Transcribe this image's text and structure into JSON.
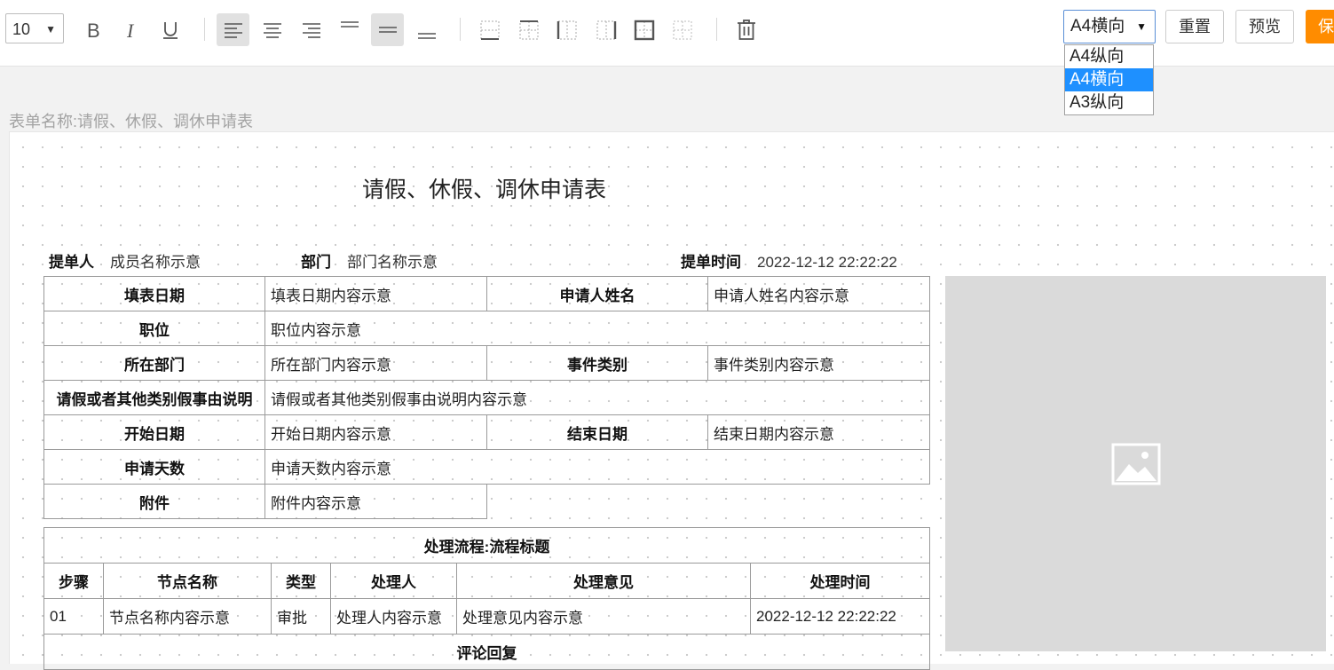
{
  "toolbar": {
    "font_size": "10",
    "paper_size": "A4横向",
    "reset_label": "重置",
    "preview_label": "预览",
    "primary_label": "保",
    "paper_options": [
      "A4纵向",
      "A4横向",
      "A3纵向"
    ]
  },
  "form_name": {
    "label": "表单名称:",
    "value": "请假、休假、调休申请表"
  },
  "document": {
    "title": "请假、休假、调休申请表",
    "submitter_label": "提单人",
    "submitter_value": "成员名称示意",
    "dept_label": "部门",
    "dept_value": "部门名称示意",
    "time_label": "提单时间",
    "time_value": "2022-12-12 22:22:22",
    "rows": {
      "fill_date_label": "填表日期",
      "fill_date_value": "填表日期内容示意",
      "applicant_label": "申请人姓名",
      "applicant_value": "申请人姓名内容示意",
      "position_label": "职位",
      "position_value": "职位内容示意",
      "department_label": "所在部门",
      "department_value": "所在部门内容示意",
      "event_label": "事件类别",
      "event_value": "事件类别内容示意",
      "reason_label": "请假或者其他类别假事由说明",
      "reason_value": "请假或者其他类别假事由说明内容示意",
      "start_label": "开始日期",
      "start_value": "开始日期内容示意",
      "end_label": "结束日期",
      "end_value": "结束日期内容示意",
      "days_label": "申请天数",
      "days_value": "申请天数内容示意",
      "attach_label": "附件",
      "attach_value": "附件内容示意"
    },
    "flow": {
      "title": "处理流程:流程标题",
      "headers": [
        "步骤",
        "节点名称",
        "类型",
        "处理人",
        "处理意见",
        "处理时间"
      ],
      "row": [
        "01",
        "节点名称内容示意",
        "审批",
        "处理人内容示意",
        "处理意见内容示意",
        "2022-12-12 22:22:22"
      ],
      "comment_title": "评论回复"
    }
  }
}
